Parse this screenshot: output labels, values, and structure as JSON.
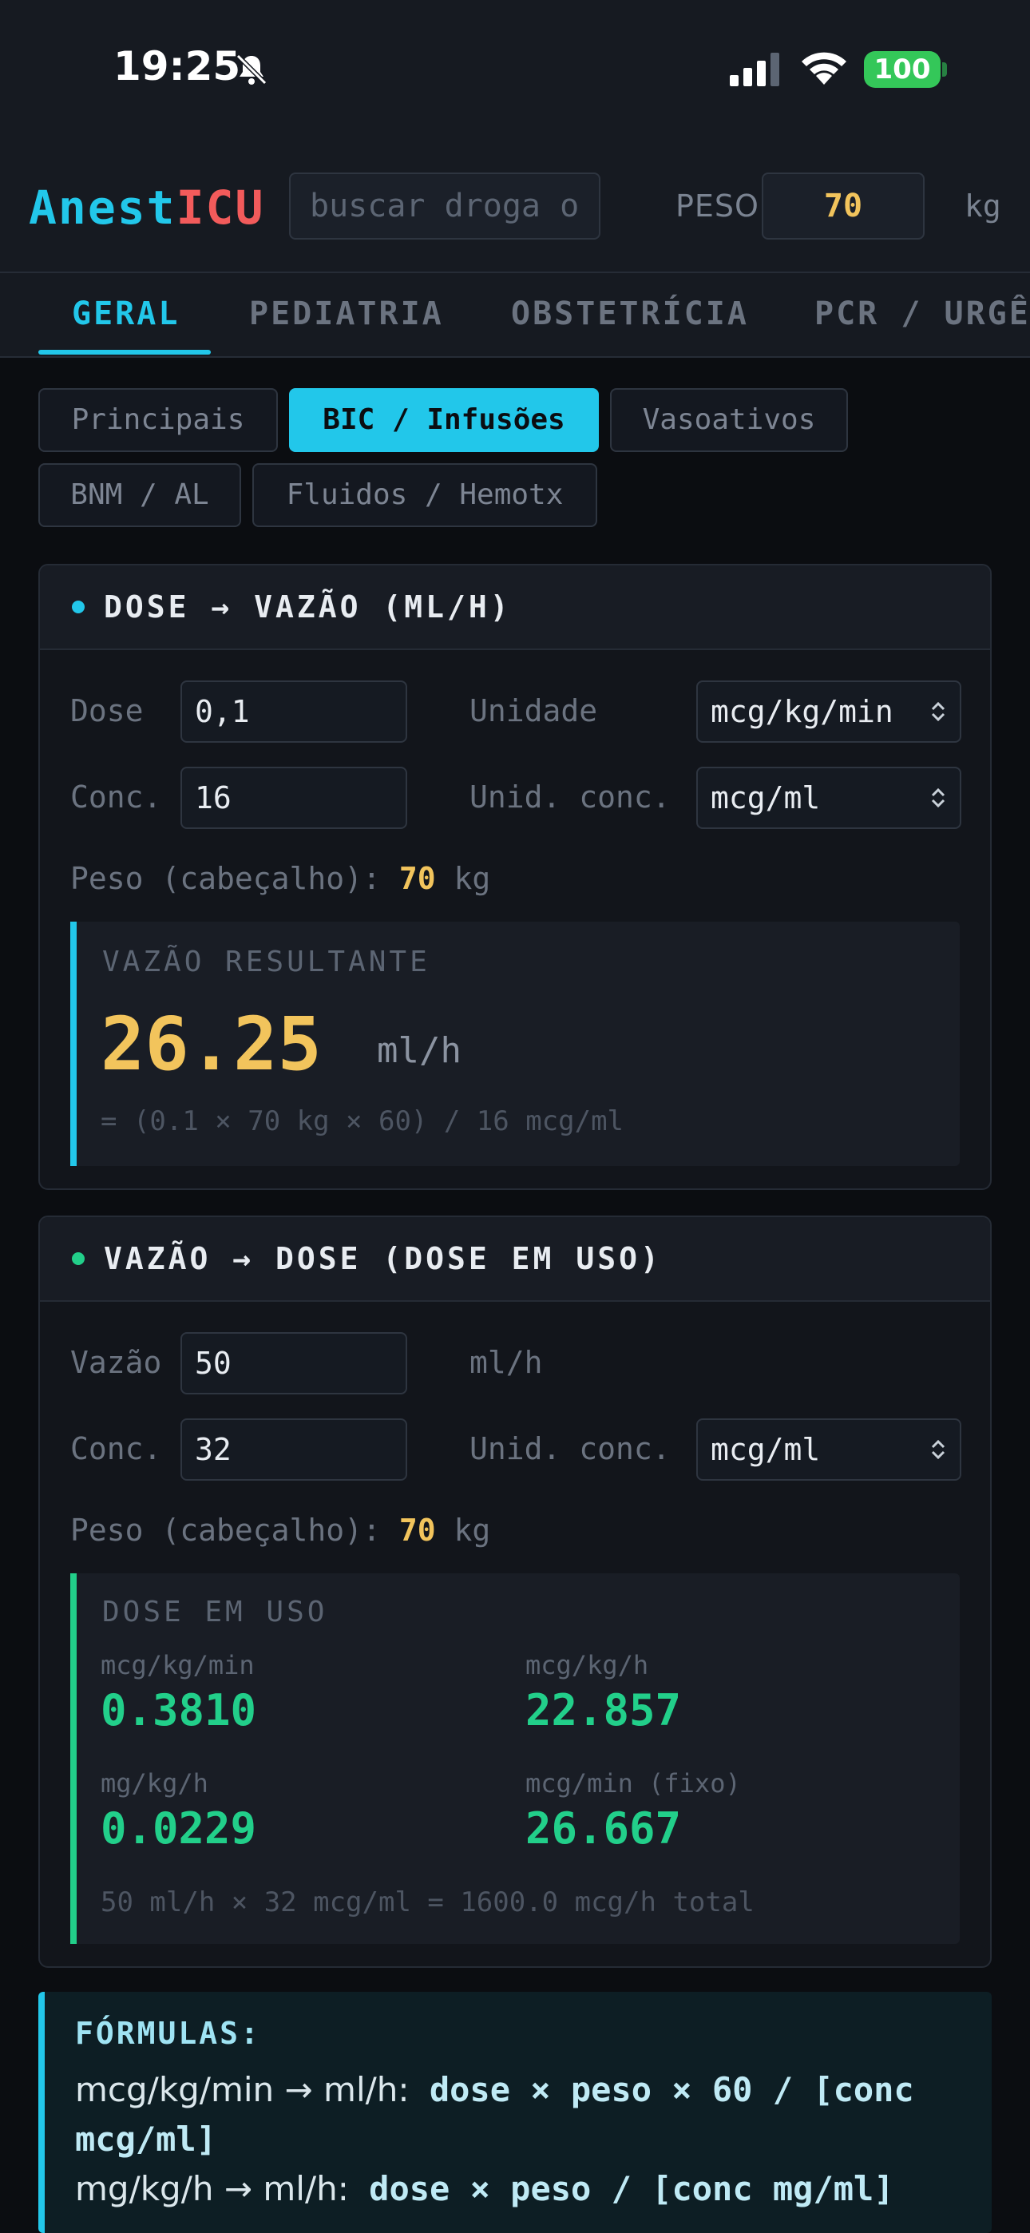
{
  "status_bar": {
    "time": "19:25",
    "battery": "100"
  },
  "header": {
    "logo_part1": "Anest",
    "logo_part2": "ICU",
    "search_placeholder": "buscar droga ou cálculo",
    "peso_label": "PESO",
    "peso_value": "70",
    "peso_unit": "kg"
  },
  "tabs": [
    {
      "label": "GERAL",
      "active": true
    },
    {
      "label": "PEDIATRIA",
      "active": false
    },
    {
      "label": "OBSTETRÍCIA",
      "active": false
    },
    {
      "label": "PCR / URGÊNCIA",
      "active": false
    }
  ],
  "subtabs": [
    {
      "label": "Principais",
      "active": false
    },
    {
      "label": "BIC / Infusões",
      "active": true
    },
    {
      "label": "Vasoativos",
      "active": false
    },
    {
      "label": "BNM / AL",
      "active": false
    },
    {
      "label": "Fluidos / Hemotx",
      "active": false
    }
  ],
  "card1": {
    "title": "DOSE → VAZÃO (ML/H)",
    "dose_label": "Dose",
    "dose_value": "0,1",
    "unidade_label": "Unidade",
    "unidade_value": "mcg/kg/min",
    "conc_label": "Conc.",
    "conc_value": "16",
    "unid_conc_label": "Unid. conc.",
    "unid_conc_value": "mcg/ml",
    "peso_prefix": "Peso (cabeçalho):",
    "peso_value": "70",
    "peso_unit": "kg",
    "result_title": "VAZÃO RESULTANTE",
    "result_value": "26.25",
    "result_unit": "ml/h",
    "result_formula": "= (0.1 × 70 kg × 60) / 16 mcg/ml"
  },
  "card2": {
    "title": "VAZÃO → DOSE (DOSE EM USO)",
    "vazao_label": "Vazão",
    "vazao_value": "50",
    "vazao_unit": "ml/h",
    "conc_label": "Conc.",
    "conc_value": "32",
    "unid_conc_label": "Unid. conc.",
    "unid_conc_value": "mcg/ml",
    "peso_prefix": "Peso (cabeçalho):",
    "peso_value": "70",
    "peso_unit": "kg",
    "result_title": "DOSE EM USO",
    "metrics": [
      {
        "label": "mcg/kg/min",
        "value": "0.3810"
      },
      {
        "label": "mcg/kg/h",
        "value": "22.857"
      },
      {
        "label": "mg/kg/h",
        "value": "0.0229"
      },
      {
        "label": "mcg/min (fixo)",
        "value": "26.667"
      }
    ],
    "total_line": "50 ml/h × 32 mcg/ml = 1600.0 mcg/h total"
  },
  "formulas": {
    "title": "FÓRMULAS:",
    "line1_prefix": "mcg/kg/min → ml/h:",
    "line1_formula_a": "dose × peso × 60 / [conc",
    "line1_formula_b": "mcg/ml]",
    "line2_prefix": "mg/kg/h → ml/h:",
    "line2_formula": "dose × peso / [conc mg/ml]"
  },
  "colors": {
    "accent_cyan": "#22c7ea",
    "accent_red": "#f25b5b",
    "result_yellow": "#f2c45c",
    "result_green": "#22cf8a",
    "battery_green": "#34c759"
  }
}
